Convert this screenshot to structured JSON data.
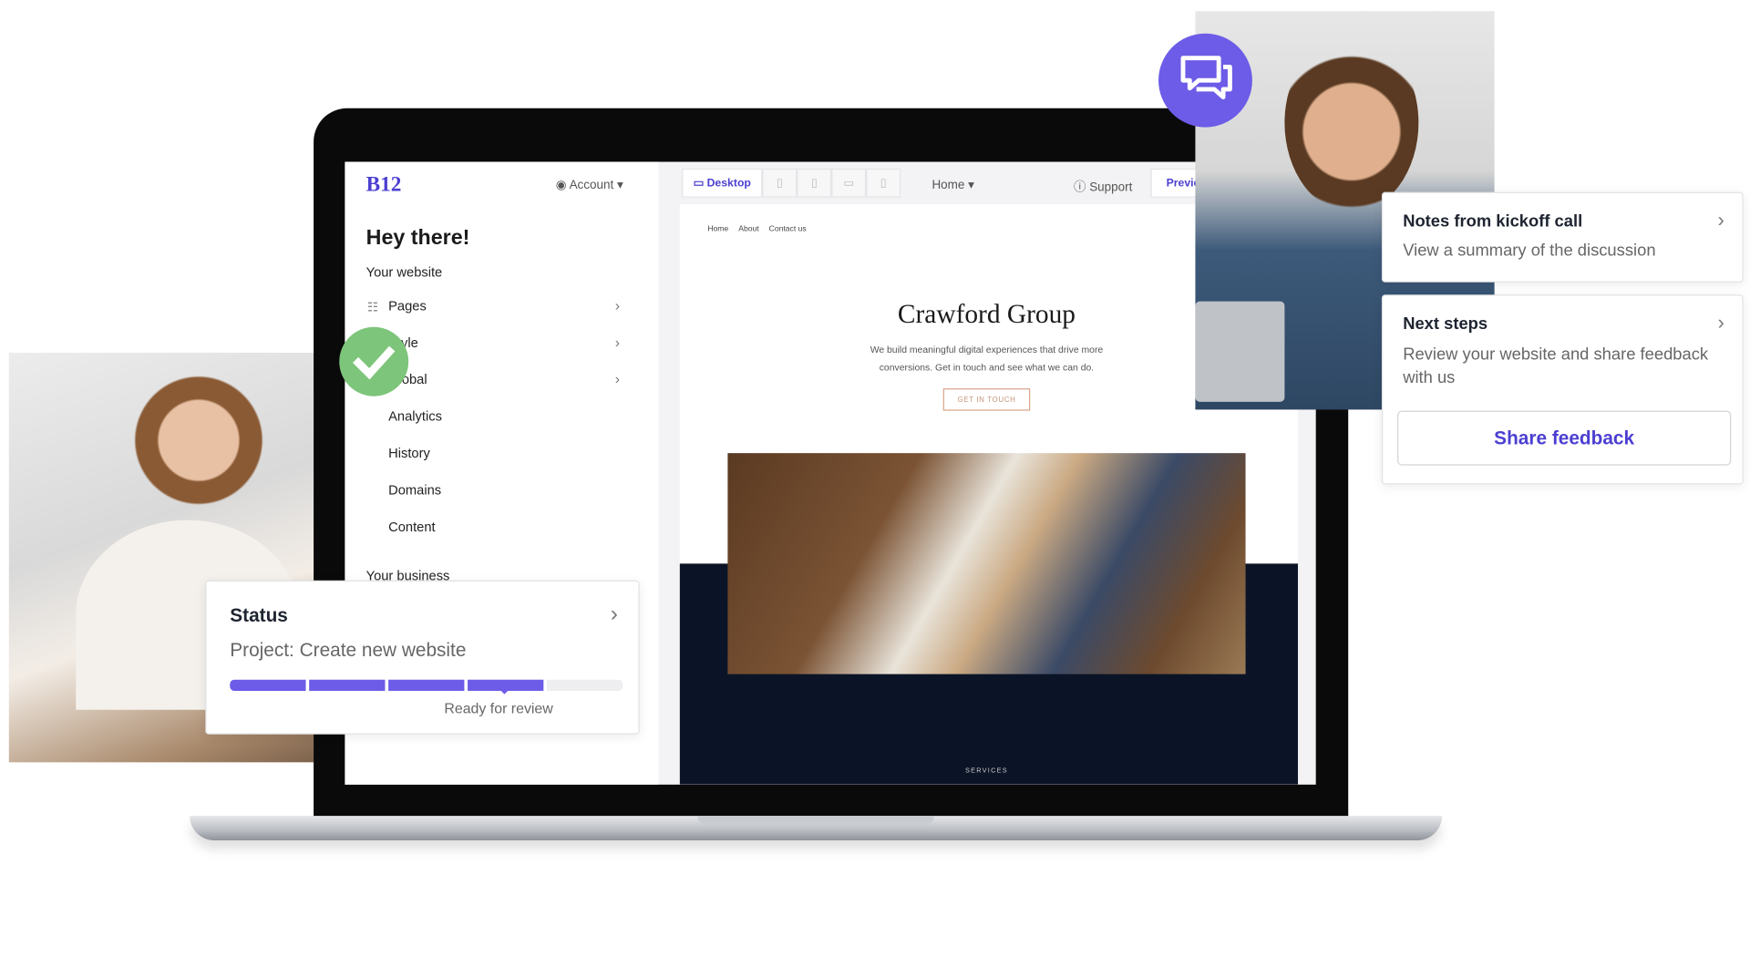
{
  "app": {
    "logo": "B12",
    "account": "Account",
    "greeting": "Hey there!",
    "section": "Your website",
    "nav": [
      {
        "label": "Pages",
        "chevron": true
      },
      {
        "label": "Style",
        "chevron": true
      },
      {
        "label": "Global",
        "chevron": true
      },
      {
        "label": "Analytics"
      },
      {
        "label": "History"
      },
      {
        "label": "Domains"
      },
      {
        "label": "Content"
      },
      {
        "label": "Your business"
      }
    ]
  },
  "toolbar": {
    "desktop": "Desktop",
    "page_select": "Home",
    "support": "Support",
    "preview": "Preview",
    "devices": [
      "tablet-landscape-icon",
      "tablet-icon",
      "laptop-icon",
      "phone-icon"
    ]
  },
  "site": {
    "nav": [
      "Home",
      "About",
      "Contact us"
    ],
    "title": "Crawford Group",
    "subtitle_line1": "We build meaningful digital experiences that drive more",
    "subtitle_line2": "conversions. Get in touch and see what we can do.",
    "cta": "GET IN TOUCH",
    "section_label": "SERVICES"
  },
  "status": {
    "title": "Status",
    "project": "Project: Create new website",
    "progress_steps_total": 5,
    "progress_steps_done": 4,
    "progress_label": "Ready for review"
  },
  "notes": {
    "title": "Notes from kickoff call",
    "subtitle": "View a summary of the discussion"
  },
  "next": {
    "title": "Next steps",
    "subtitle": "Review your website and share feedback with us",
    "button": "Share feedback"
  },
  "colors": {
    "accent": "#4b3fd1",
    "progress": "#6c5ce7",
    "check": "#7dc57a",
    "chat": "#6c5ce7",
    "navy": "#0b1426",
    "cta_border": "#d9a58a"
  }
}
